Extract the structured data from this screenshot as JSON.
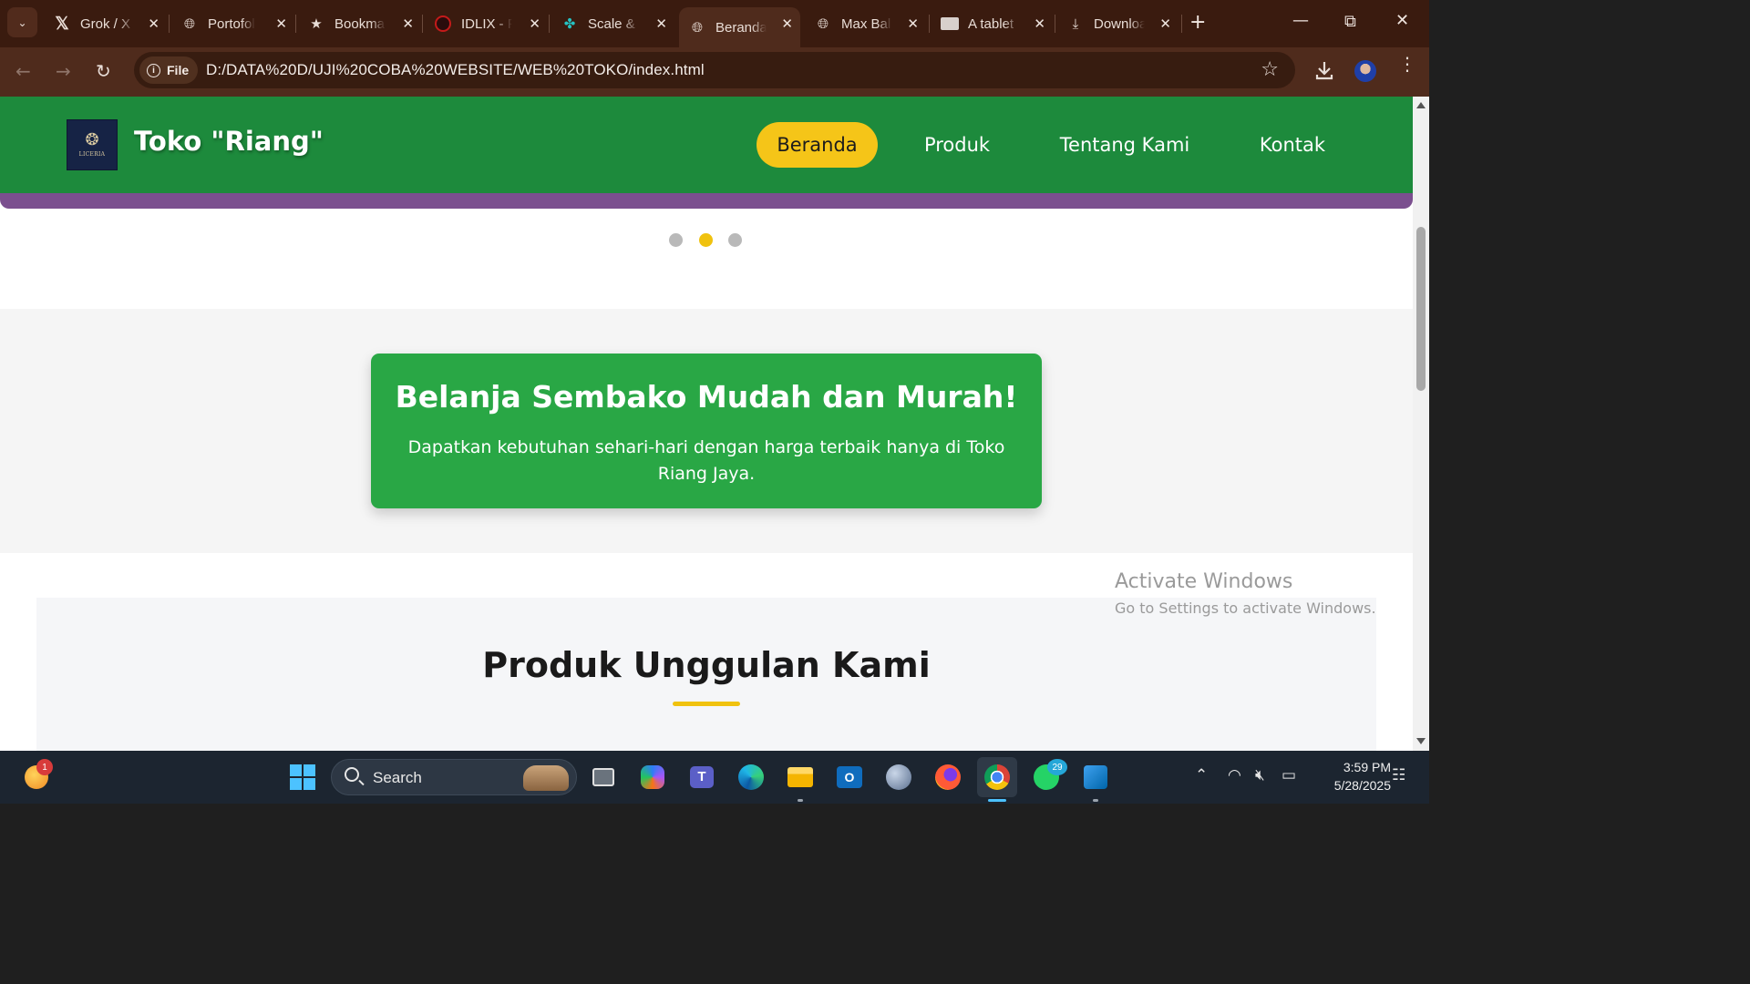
{
  "browser": {
    "tabs": [
      {
        "title": "Grok / X",
        "icon": "x-logo-icon"
      },
      {
        "title": "Portofolio",
        "icon": "globe-icon"
      },
      {
        "title": "Bookmarks",
        "icon": "star-icon"
      },
      {
        "title": "IDLIX - F",
        "icon": "idlix-icon"
      },
      {
        "title": "Scale &",
        "icon": "scale-icon"
      },
      {
        "title": "Beranda",
        "icon": "globe-icon",
        "active": true
      },
      {
        "title": "Max Bal",
        "icon": "globe-icon"
      },
      {
        "title": "A tablet",
        "icon": "tablet-icon"
      },
      {
        "title": "Download",
        "icon": "download-icon"
      }
    ],
    "new_tab_label": "+",
    "file_chip_label": "File",
    "url": "D:/DATA%20D/UJI%20COBA%20WEBSITE/WEB%20TOKO/index.html"
  },
  "site": {
    "brand": "Toko \"Riang\"",
    "logo_wordmark": "LICERIA",
    "nav": [
      {
        "label": "Beranda",
        "active": true
      },
      {
        "label": "Produk"
      },
      {
        "label": "Tentang Kami"
      },
      {
        "label": "Kontak"
      }
    ],
    "carousel": {
      "dot_count": 3,
      "active_index": 1
    },
    "promo": {
      "title": "Belanja Sembako Mudah dan Murah!",
      "text": "Dapatkan kebutuhan sehari-hari dengan harga terbaik hanya di Toko Riang Jaya."
    },
    "products_title": "Produk Unggulan Kami",
    "colors": {
      "header_green": "#1d8a3c",
      "accent_yellow": "#f5c518",
      "promo_green": "#29a745",
      "strip_purple": "#7b4f8f"
    }
  },
  "watermark": {
    "title": "Activate Windows",
    "subtitle": "Go to Settings to activate Windows."
  },
  "taskbar": {
    "search_label": "Search",
    "notification_badge": "1",
    "whatsapp_badge": "29",
    "time": "3:59 PM",
    "date": "5/28/2025",
    "apps": [
      "windows-start-icon",
      "task-view-icon",
      "copilot-icon",
      "teams-icon",
      "edge-icon",
      "file-explorer-icon",
      "outlook-icon",
      "remote-app-icon",
      "firefox-icon",
      "chrome-icon",
      "whatsapp-icon",
      "vscode-icon"
    ]
  }
}
